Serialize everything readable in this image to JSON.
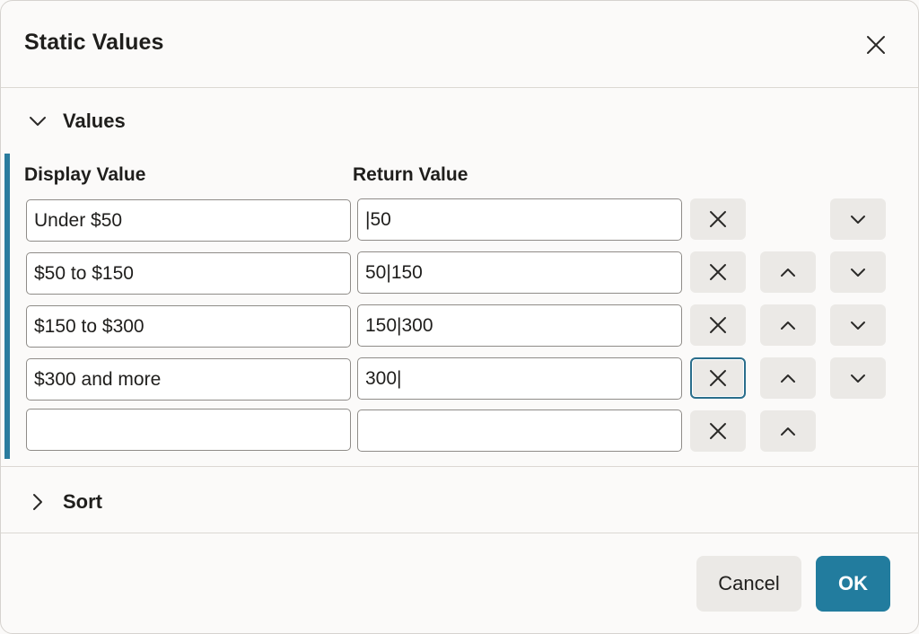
{
  "dialog": {
    "title": "Static Values",
    "close_icon": "close-icon"
  },
  "values_section": {
    "label": "Values",
    "expanded": true,
    "columns": {
      "display": "Display Value",
      "return": "Return Value"
    },
    "rows": [
      {
        "display": "Under $50",
        "return": "|50",
        "has_up": false,
        "has_down": true
      },
      {
        "display": "$50 to $150",
        "return": "50|150",
        "has_up": true,
        "has_down": true
      },
      {
        "display": "$150 to $300",
        "return": "150|300",
        "has_up": true,
        "has_down": true
      },
      {
        "display": "$300 and more",
        "return": "300|",
        "has_up": true,
        "has_down": true,
        "remove_focused": true
      },
      {
        "display": "",
        "return": "",
        "has_up": true,
        "has_down": false
      }
    ]
  },
  "sort_section": {
    "label": "Sort",
    "expanded": false
  },
  "footer": {
    "cancel_label": "Cancel",
    "ok_label": "OK"
  },
  "colors": {
    "accent": "#227c9e",
    "focus_border": "#2a6e8c",
    "button_bg": "#ebe9e6"
  }
}
